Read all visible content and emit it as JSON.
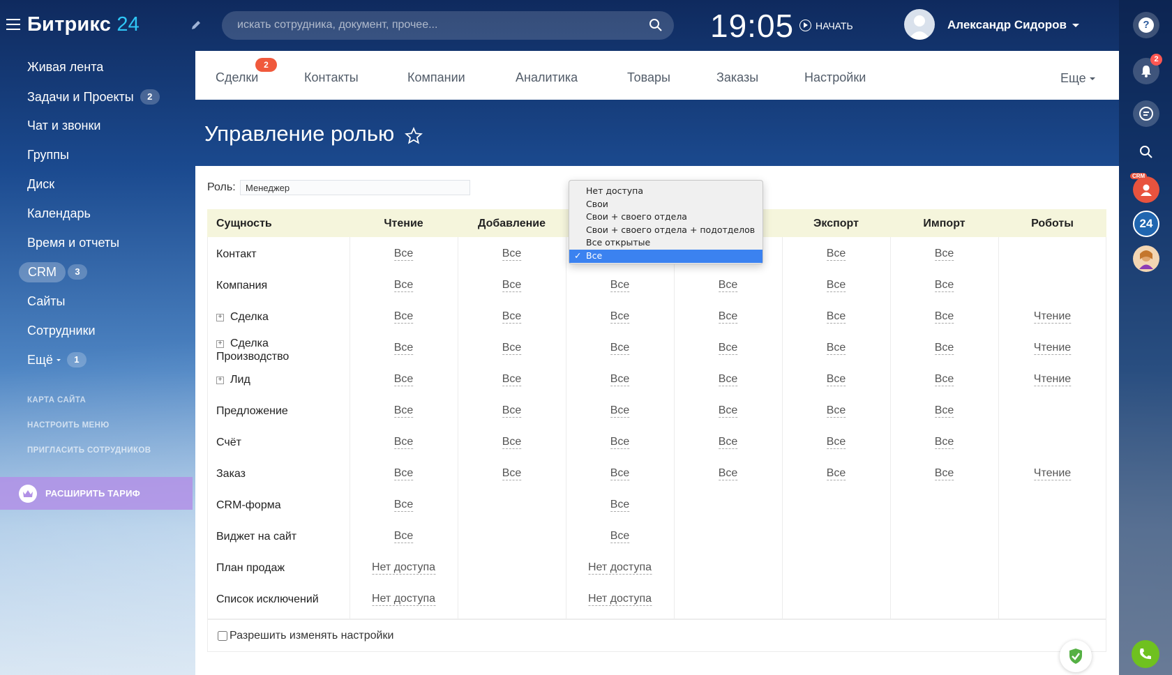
{
  "app": {
    "logo_name": "Битрикс",
    "logo_num": "24",
    "search_placeholder": "искать сотрудника, документ, прочее...",
    "clock": "19:05",
    "start_label": "НАЧАТЬ",
    "user_name": "Александр Сидоров"
  },
  "sidebar": {
    "items": [
      {
        "label": "Живая лента"
      },
      {
        "label": "Задачи и Проекты",
        "badge": "2"
      },
      {
        "label": "Чат и звонки"
      },
      {
        "label": "Группы"
      },
      {
        "label": "Диск"
      },
      {
        "label": "Календарь"
      },
      {
        "label": "Время и отчеты"
      },
      {
        "label": "CRM",
        "badge": "3"
      },
      {
        "label": "Сайты"
      },
      {
        "label": "Сотрудники"
      },
      {
        "label": "Ещё",
        "badge": "1"
      }
    ],
    "links": [
      "КАРТА САЙТА",
      "НАСТРОИТЬ МЕНЮ",
      "ПРИГЛАСИТЬ СОТРУДНИКОВ"
    ],
    "upgrade_label": "РАСШИРИТЬ ТАРИФ"
  },
  "tabs": {
    "items": [
      "Сделки",
      "Контакты",
      "Компании",
      "Аналитика",
      "Товары",
      "Заказы",
      "Настройки"
    ],
    "deals_badge": "2",
    "more_label": "Еще"
  },
  "rail": {
    "notifications_badge": "2",
    "crm_label": "CRM",
    "b24_label": "24",
    "help_label": "?"
  },
  "page": {
    "title": "Управление ролью",
    "role_label": "Роль:",
    "role_value": "Менеджер",
    "allow_settings_label": "Разрешить изменять настройки"
  },
  "table": {
    "headers": [
      "Сущность",
      "Чтение",
      "Добавление",
      "",
      "",
      "Экспорт",
      "Импорт",
      "Роботы"
    ],
    "rows": [
      {
        "name": "Контакт",
        "expandable": false,
        "cells": [
          "Все",
          "Все",
          "",
          "",
          "Все",
          "Все",
          ""
        ]
      },
      {
        "name": "Компания",
        "expandable": false,
        "cells": [
          "Все",
          "Все",
          "Все",
          "Все",
          "Все",
          "Все",
          ""
        ]
      },
      {
        "name": "Сделка",
        "expandable": true,
        "cells": [
          "Все",
          "Все",
          "Все",
          "Все",
          "Все",
          "Все",
          "Чтение"
        ]
      },
      {
        "name": "Сделка Производство",
        "expandable": true,
        "cells": [
          "Все",
          "Все",
          "Все",
          "Все",
          "Все",
          "Все",
          "Чтение"
        ]
      },
      {
        "name": "Лид",
        "expandable": true,
        "cells": [
          "Все",
          "Все",
          "Все",
          "Все",
          "Все",
          "Все",
          "Чтение"
        ]
      },
      {
        "name": "Предложение",
        "expandable": false,
        "cells": [
          "Все",
          "Все",
          "Все",
          "Все",
          "Все",
          "Все",
          ""
        ]
      },
      {
        "name": "Счёт",
        "expandable": false,
        "cells": [
          "Все",
          "Все",
          "Все",
          "Все",
          "Все",
          "Все",
          ""
        ]
      },
      {
        "name": "Заказ",
        "expandable": false,
        "cells": [
          "Все",
          "Все",
          "Все",
          "Все",
          "Все",
          "Все",
          "Чтение"
        ]
      },
      {
        "name": "CRM-форма",
        "expandable": false,
        "cells": [
          "Все",
          "",
          "Все",
          "",
          "",
          "",
          ""
        ]
      },
      {
        "name": "Виджет на сайт",
        "expandable": false,
        "cells": [
          "Все",
          "",
          "Все",
          "",
          "",
          "",
          ""
        ]
      },
      {
        "name": "План продаж",
        "expandable": false,
        "cells": [
          "Нет доступа",
          "",
          "Нет доступа",
          "",
          "",
          "",
          ""
        ]
      },
      {
        "name": "Список исключений",
        "expandable": false,
        "cells": [
          "Нет доступа",
          "",
          "Нет доступа",
          "",
          "",
          "",
          ""
        ]
      }
    ]
  },
  "dropdown": {
    "options": [
      "Нет доступа",
      "Свои",
      "Свои + своего отдела",
      "Свои + своего отдела + подотделов",
      "Все открытые",
      "Все"
    ],
    "selected": "Все"
  }
}
